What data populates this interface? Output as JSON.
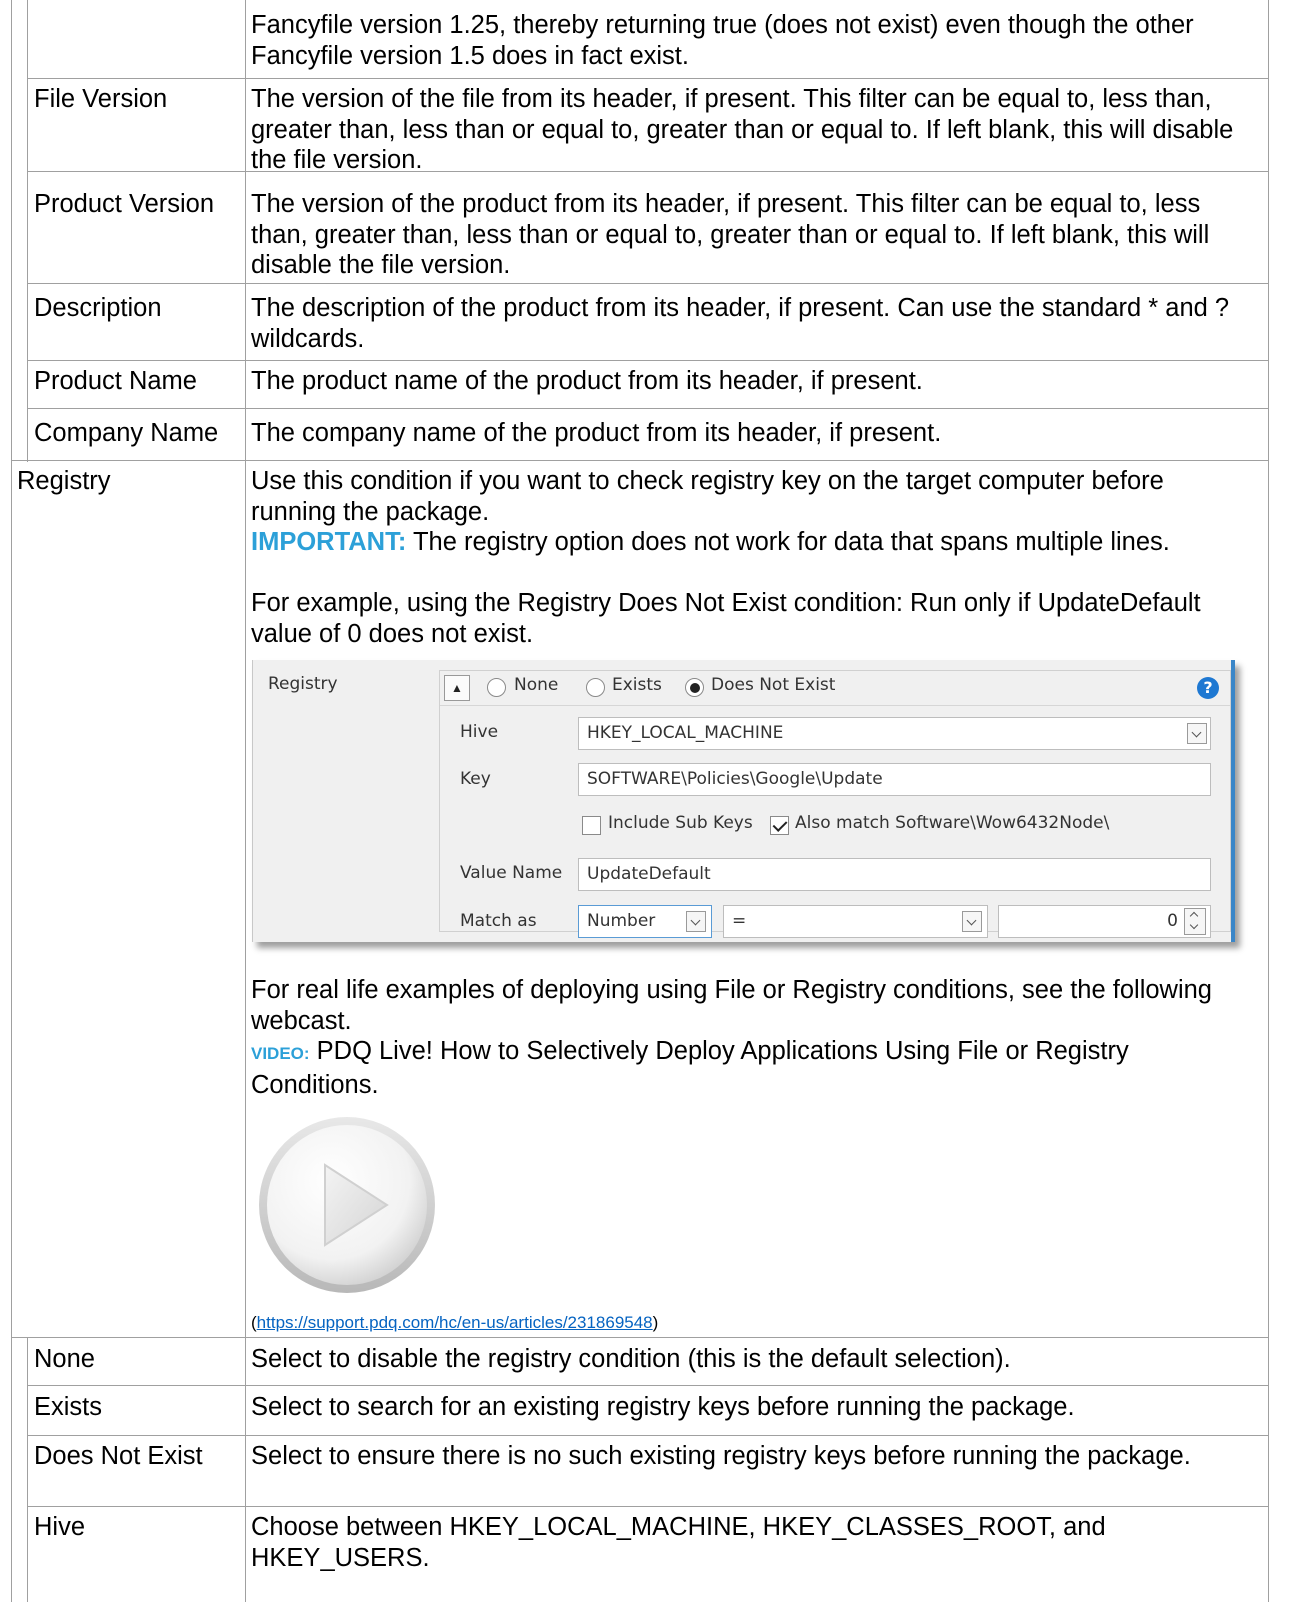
{
  "rows": {
    "fancyfile_cont": {
      "desc": "Fancyfile version 1.25, thereby returning true (does not exist) even though the other Fancyfile version 1.5 does in fact exist."
    },
    "file_version": {
      "label": "File Version",
      "desc": "The version of the file from its header, if present. This filter can be equal to, less than, greater than, less than or equal to, greater than or equal to. If left blank, this will disable the file version."
    },
    "product_version": {
      "label": "Product Version",
      "desc": "The version of the product from its header, if present. This filter can be equal to, less than, greater than, less than or equal to, greater than or equal to. If left blank, this will disable the file version."
    },
    "description": {
      "label": "Description",
      "desc": "The description of the product from its header, if present. Can use the standard * and ? wildcards."
    },
    "product_name": {
      "label": "Product Name",
      "desc": "The product name of the product from its header, if present."
    },
    "company_name": {
      "label": "Company Name",
      "desc": "The company name of the product from its header, if present."
    },
    "registry": {
      "label": "Registry",
      "intro": "Use this condition if you want to check registry key on the target computer before running the package.",
      "important_label": "IMPORTANT:",
      "important_text": " The registry option does not work for data that spans multiple lines.",
      "example": "For example, using the Registry Does Not Exist condition: Run only if UpdateDefault value of 0 does not exist.",
      "real_life": "For real life examples of deploying using File or Registry conditions, see the following webcast.",
      "video_label": "VIDEO:",
      "video_text": " PDQ Live! How to Selectively Deploy Applications Using File or Registry Conditions.",
      "link_open": "(",
      "link_url": "https://support.pdq.com/hc/en-us/articles/231869548",
      "link_close": ")"
    },
    "none": {
      "label": "None",
      "desc": "Select to disable the registry condition (this is the default selection)."
    },
    "exists": {
      "label": "Exists",
      "desc": "Select to search for an existing registry keys before running the package."
    },
    "does_not_exist": {
      "label": "Does Not Exist",
      "desc": "Select to ensure there is no such existing registry keys before running the package."
    },
    "hive": {
      "label": "Hive",
      "desc": "Choose between HKEY_LOCAL_MACHINE, HKEY_CLASSES_ROOT, and HKEY_USERS."
    }
  },
  "registry_panel": {
    "section_label": "Registry",
    "radio_none": "None",
    "radio_exists": "Exists",
    "radio_does_not_exist": "Does Not Exist",
    "selected_radio": "Does Not Exist",
    "help_icon": "question-icon",
    "hive_label": "Hive",
    "hive_value": "HKEY_LOCAL_MACHINE",
    "key_label": "Key",
    "key_value": "SOFTWARE\\Policies\\Google\\Update",
    "include_sub_keys": "Include Sub Keys",
    "include_sub_keys_checked": false,
    "also_match": "Also match Software\\Wow6432Node\\",
    "also_match_checked": true,
    "value_name_label": "Value Name",
    "value_name_value": "UpdateDefault",
    "match_as_label": "Match as",
    "match_as_value": "Number",
    "operator_value": "=",
    "compare_value": "0"
  },
  "colors": {
    "accent": "#2ca0d8",
    "link": "#0563c1",
    "grid": "#a0a0a0",
    "panel_border": "#3a86c8",
    "help_icon": "#1e78d2"
  }
}
